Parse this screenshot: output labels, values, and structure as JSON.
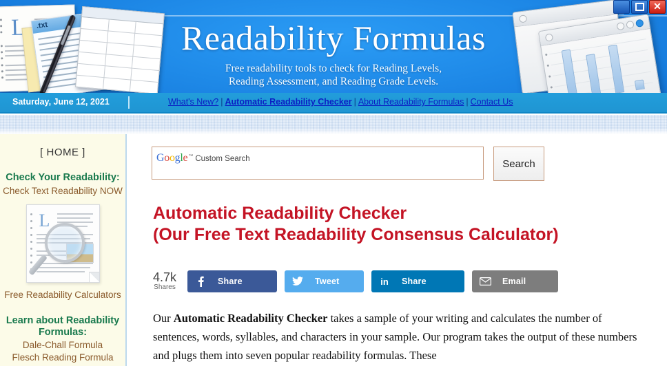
{
  "window": {
    "minimize_label": "_",
    "maximize_label": "",
    "close_label": "✕"
  },
  "banner": {
    "title": "Readability Formulas",
    "subtitle_line1": "Free readability tools to check for Reading Levels,",
    "subtitle_line2": "Reading Assessment, and Reading Grade Levels.",
    "note_tab_label": ".txt"
  },
  "nav": {
    "date": "Saturday, June 12, 2021",
    "links": [
      {
        "label": "What's New?",
        "bold": false
      },
      {
        "label": "Automatic Readability Checker",
        "bold": true
      },
      {
        "label": "About Readability Formulas",
        "bold": false
      },
      {
        "label": "Contact Us",
        "bold": false
      }
    ],
    "separator": "|"
  },
  "sidebar": {
    "home_label": "[ HOME ]",
    "check_heading": "Check Your Readability:",
    "check_link": "Check Text Readability NOW",
    "calculators_link": "Free Readability Calculators",
    "learn_heading_line1": "Learn about Readability",
    "learn_heading_line2": "Formulas:",
    "formula_links": [
      "Dale-Chall Formula",
      "Flesch Reading Formula"
    ]
  },
  "search": {
    "google_g": "G",
    "google_o1": "o",
    "google_o2": "o",
    "google_g2": "g",
    "google_l": "l",
    "google_e": "e",
    "trademark": "™",
    "placeholder_text": "Custom Search",
    "button_label": "Search"
  },
  "main": {
    "heading_line1": "Automatic Readability Checker",
    "heading_line2": "(Our Free Text Readability Consensus Calculator)",
    "paragraph_pre": "Our ",
    "paragraph_bold": "Automatic Readability Checker",
    "paragraph_post": " takes a sample of your writing and calculates the number of sentences, words, syllables, and characters in your sample. Our program takes the output of these numbers and plugs them into seven popular readability formulas. These"
  },
  "share": {
    "count": "4.7k",
    "count_label": "Shares",
    "buttons": [
      {
        "network": "facebook",
        "label": "Share",
        "color": "#3b5998"
      },
      {
        "network": "twitter",
        "label": "Tweet",
        "color": "#55acee"
      },
      {
        "network": "linkedin",
        "label": "Share",
        "color": "#0077b5"
      },
      {
        "network": "email",
        "label": "Email",
        "color": "#7d7d7d"
      }
    ],
    "linkedin_glyph": "in"
  },
  "colors": {
    "banner_blue": "#1f8ae8",
    "nav_blue": "#229ddb",
    "heading_red": "#c41425",
    "sidebar_bg": "#fcfbe8",
    "sidebar_green": "#1a7a4e",
    "sidebar_brown": "#8a5a2b"
  }
}
